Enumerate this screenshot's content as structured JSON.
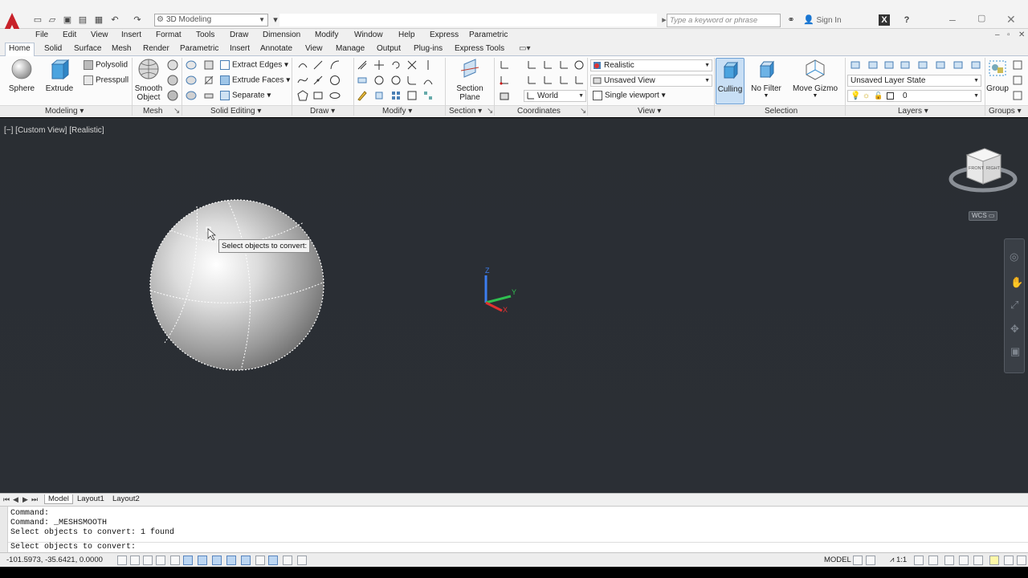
{
  "titlebar": {
    "workspace": "3D Modeling",
    "search_placeholder": "Type a keyword or phrase",
    "signin": "Sign In"
  },
  "menu": [
    "File",
    "Edit",
    "View",
    "Insert",
    "Format",
    "Tools",
    "Draw",
    "Dimension",
    "Modify",
    "Window",
    "Help",
    "Express",
    "Parametric"
  ],
  "ribbon_tabs": [
    "Home",
    "Solid",
    "Surface",
    "Mesh",
    "Render",
    "Parametric",
    "Insert",
    "Annotate",
    "View",
    "Manage",
    "Output",
    "Plug-ins",
    "Express Tools"
  ],
  "ribbon": {
    "modeling": {
      "sphere": "Sphere",
      "extrude": "Extrude",
      "polysolid": "Polysolid",
      "presspull": "Presspull",
      "title": "Modeling"
    },
    "mesh": {
      "smooth_l1": "Smooth",
      "smooth_l2": "Object",
      "title": "Mesh"
    },
    "solid_editing": {
      "extract_edges": "Extract Edges",
      "extrude_faces": "Extrude Faces",
      "separate": "Separate",
      "title": "Solid Editing"
    },
    "draw": {
      "title": "Draw"
    },
    "modify": {
      "title": "Modify"
    },
    "section": {
      "l1": "Section",
      "l2": "Plane",
      "title": "Section"
    },
    "coordinates": {
      "world": "World",
      "title": "Coordinates"
    },
    "view": {
      "visual_style": "Realistic",
      "named_view": "Unsaved View",
      "viewport": "Single viewport",
      "title": "View"
    },
    "selection": {
      "culling": "Culling",
      "no_filter": "No Filter",
      "move_gizmo": "Move Gizmo",
      "title": "Selection"
    },
    "layers": {
      "layer_state": "Unsaved Layer State",
      "current_layer": "0",
      "title": "Layers"
    },
    "groups": {
      "group": "Group",
      "title": "Groups"
    }
  },
  "viewport": {
    "label": "[−] [Custom View] [Realistic]",
    "tooltip": "Select objects to convert:",
    "wcs": "WCS",
    "viewcube_front": "FRONT",
    "viewcube_right": "RIGHT",
    "axis_x": "X",
    "axis_y": "Y",
    "axis_z": "Z"
  },
  "layout_tabs": [
    "Model",
    "Layout1",
    "Layout2"
  ],
  "command": {
    "lines": [
      "Command:",
      "Command: _MESHSMOOTH",
      "Select objects to convert: 1 found"
    ],
    "input": "Select objects to convert:"
  },
  "status": {
    "coords": "-101.5973, -35.6421, 0.0000",
    "model": "MODEL",
    "scale": "1:1"
  }
}
